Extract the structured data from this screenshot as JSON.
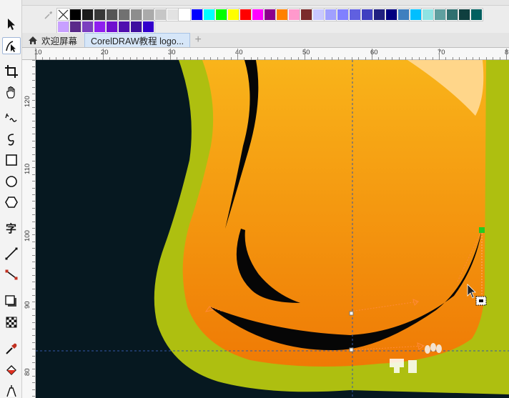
{
  "palette": {
    "row1": [
      "#000000",
      "#1c1c1c",
      "#383838",
      "#555555",
      "#717171",
      "#8d8d8d",
      "#aaaaaa",
      "#c6c6c6",
      "#e2e2e2",
      "#ffffff",
      "#0000ff",
      "#00ffff",
      "#00ff00",
      "#ffff00",
      "#ff0000",
      "#ff00ff",
      "#8b008b",
      "#ff8000",
      "#ff99cc",
      "#7b2b2b",
      "#c8c8ff",
      "#a0a0ff",
      "#8080ff",
      "#6060e0",
      "#4040c0",
      "#202080",
      "#000080",
      "#3f7fbf",
      "#00bfff",
      "#8fe3e3",
      "#5f9f9f",
      "#2f6f6f",
      "#0f3f3f",
      "#005f5f"
    ],
    "row2": [
      "#c8a0ff",
      "#5a2a8a",
      "#7b3fbf",
      "#8f1fef",
      "#6f0fcf",
      "#4f0faf",
      "#3f0f9f",
      "#3300cc"
    ]
  },
  "tabs": {
    "welcome_label": "欢迎屏幕",
    "doc_label": "CorelDRAW教程 logo...",
    "add_label": "+"
  },
  "ruler_top": {
    "labels": [
      "10",
      "20",
      "30",
      "40",
      "50",
      "60",
      "70",
      "8"
    ]
  },
  "ruler_left": {
    "labels": [
      "120",
      "110",
      "100",
      "90",
      "80"
    ]
  },
  "colors": {
    "canvas_bg": "#061820",
    "outer_green": "#aebf10",
    "orange_top": "#f9b41a",
    "orange_bottom": "#ef7a05",
    "highlight": "#ffd68a",
    "node_green": "#22cc22"
  },
  "icons": {
    "toolbox": [
      "pick-tool-icon",
      "shape-tool-icon",
      "crop-tool-icon",
      "pan-tool-icon",
      "freehand-tool-icon",
      "smart-draw-icon",
      "rectangle-tool-icon",
      "ellipse-tool-icon",
      "polygon-tool-icon",
      "text-tool-icon",
      "dimension-tool-icon",
      "connector-tool-icon",
      "drop-shadow-icon",
      "transparency-icon",
      "eyedropper-icon",
      "fill-icon",
      "outline-pen-icon"
    ]
  }
}
